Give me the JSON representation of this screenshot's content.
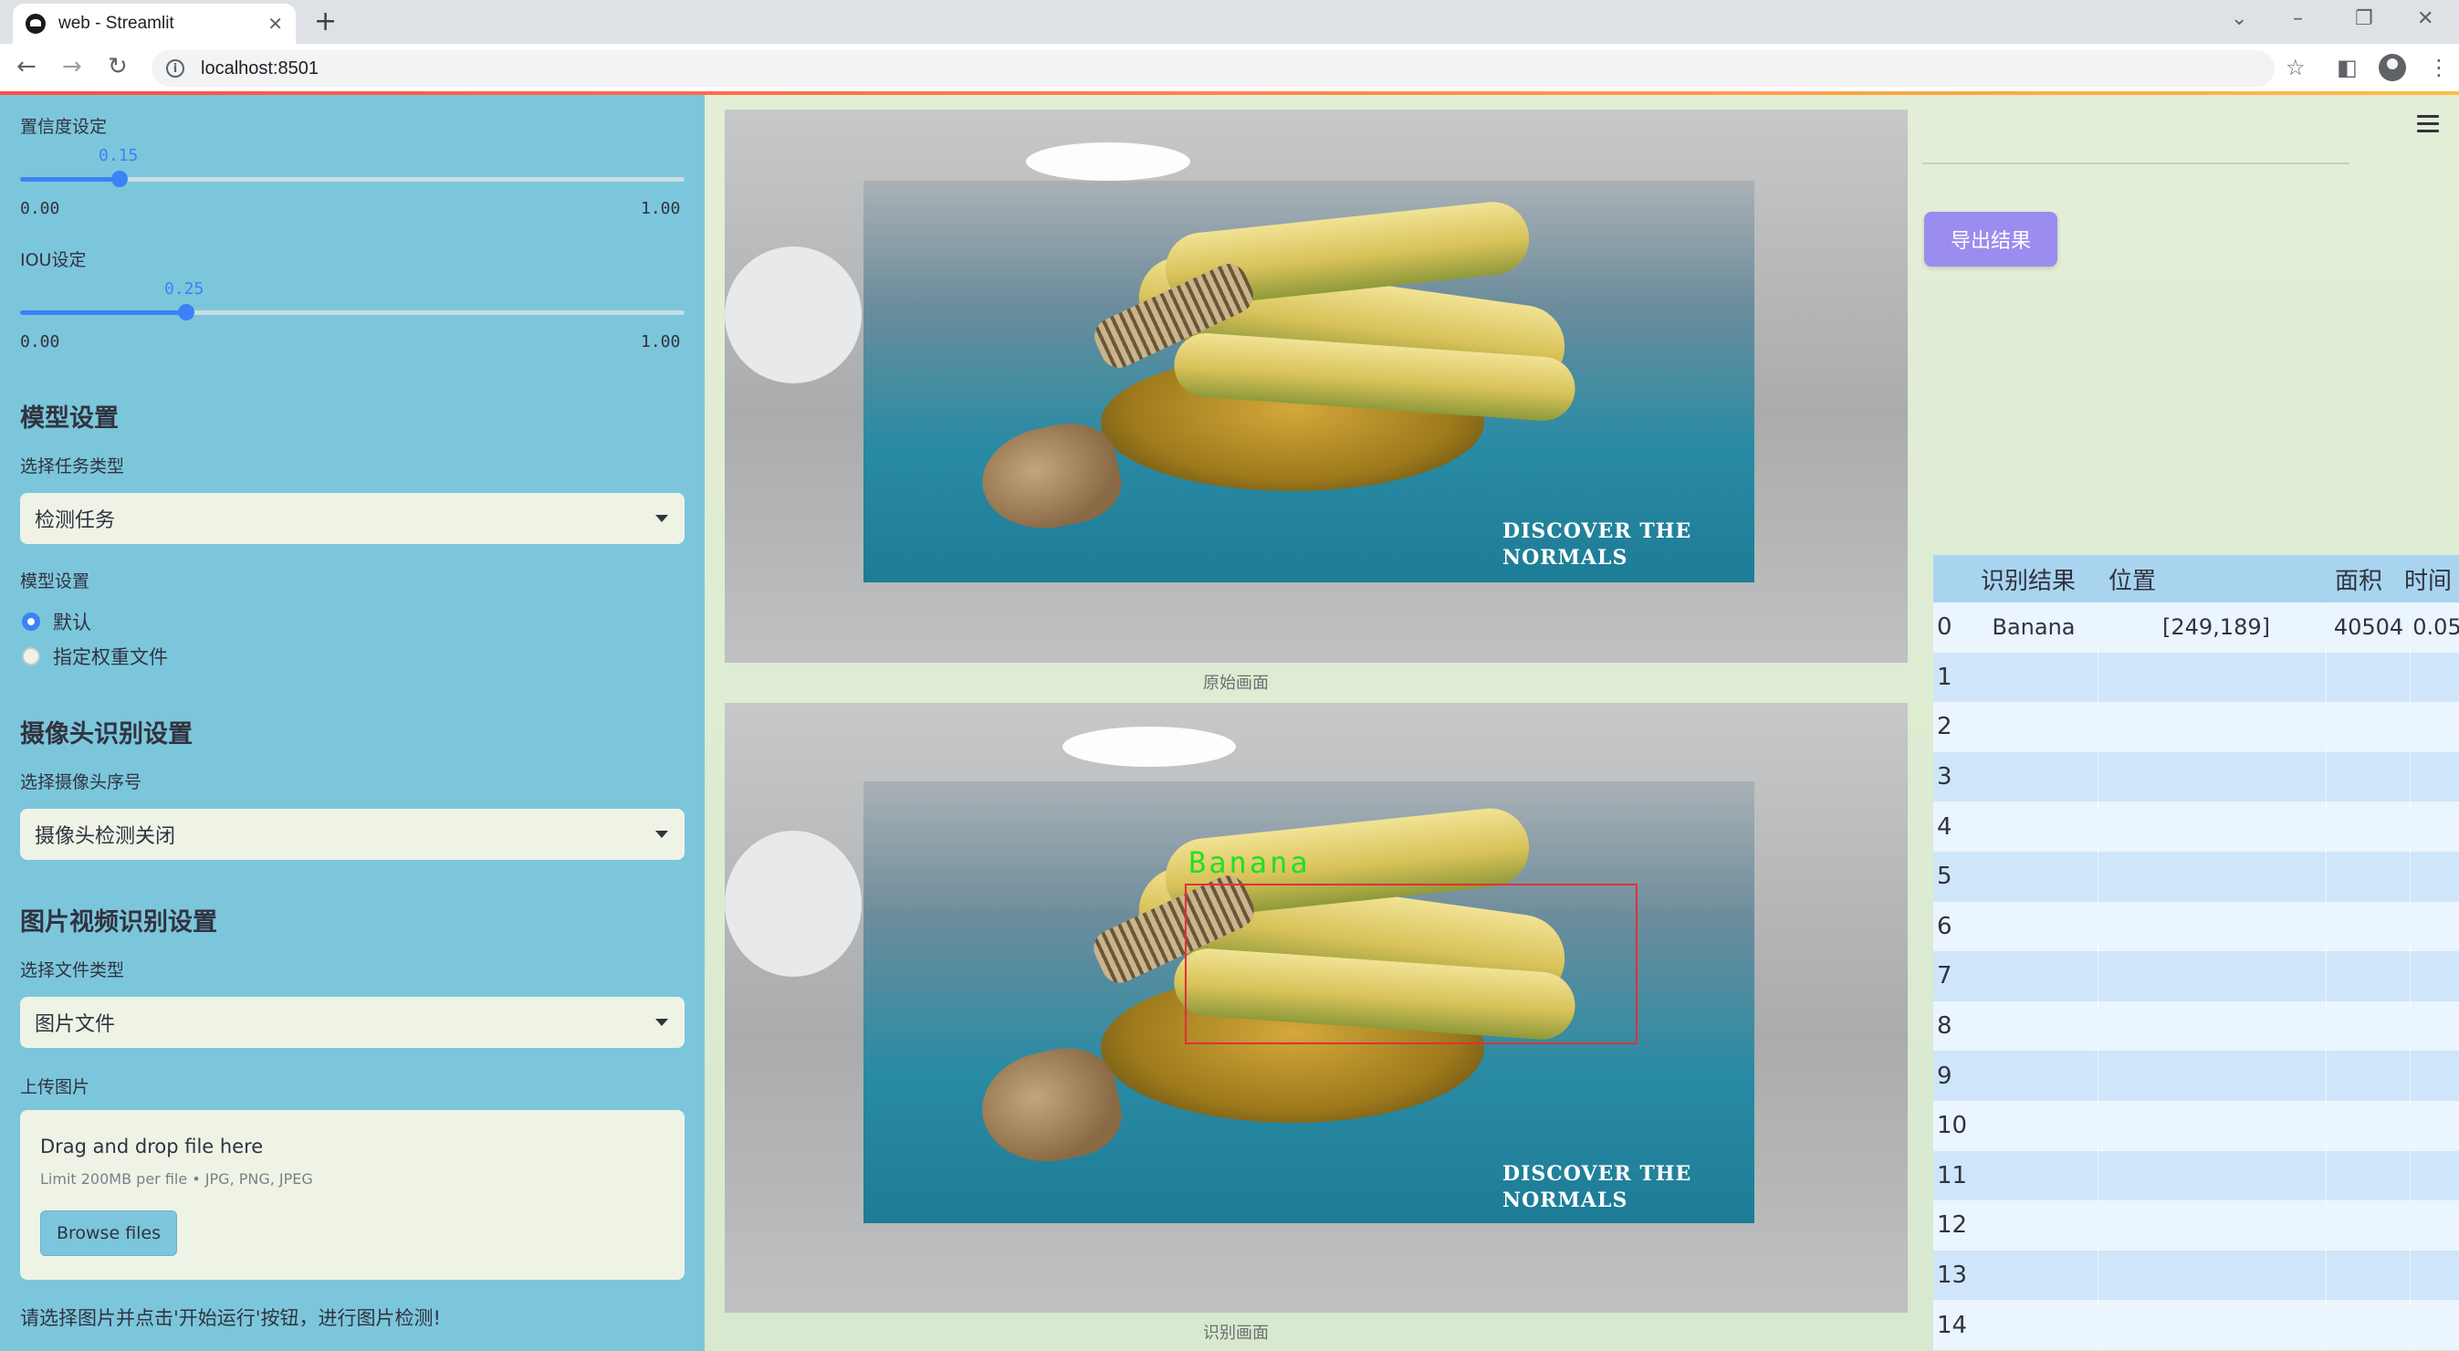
{
  "browser": {
    "tab_title": "web - Streamlit",
    "url": "localhost:8501",
    "new_tab_icon": "plus-icon",
    "close_tab_icon": "close-icon"
  },
  "sidebar": {
    "confidence": {
      "label": "置信度设定",
      "value": "0.15",
      "fraction": 0.15,
      "min": "0.00",
      "max": "1.00"
    },
    "iou": {
      "label": "IOU设定",
      "value": "0.25",
      "fraction": 0.25,
      "min": "0.00",
      "max": "1.00"
    },
    "model_section": {
      "heading": "模型设置",
      "task_label": "选择任务类型",
      "task_value": "检测任务",
      "model_label": "模型设置",
      "radio_options": [
        "默认",
        "指定权重文件"
      ],
      "radio_selected": 0
    },
    "camera_section": {
      "heading": "摄像头识别设置",
      "camera_label": "选择摄像头序号",
      "camera_value": "摄像头检测关闭"
    },
    "media_section": {
      "heading": "图片视频识别设置",
      "filetype_label": "选择文件类型",
      "filetype_value": "图片文件",
      "upload_label": "上传图片",
      "drop_text": "Drag and drop file here",
      "limit_text": "Limit 200MB per file • JPG, PNG, JPEG",
      "browse_label": "Browse files"
    },
    "hint": "请选择图片并点击'开始运行'按钮，进行图片检测!"
  },
  "main": {
    "original_caption": "原始画面",
    "detected_caption": "识别画面",
    "photo_text_line1": "DISCOVER THE",
    "photo_text_line2": "NORMALS",
    "detection_label": "Banana"
  },
  "right_panel": {
    "export_label": "导出结果",
    "menu_icon": "hamburger-menu-icon",
    "table": {
      "columns": [
        "",
        "识别结果",
        "位置",
        "面积",
        "时间"
      ],
      "rows": [
        {
          "index": "0",
          "result": "Banana",
          "position": "[249,189]",
          "area": "40504",
          "time": "0.05"
        },
        {
          "index": "1",
          "result": "",
          "position": "",
          "area": "",
          "time": ""
        },
        {
          "index": "2",
          "result": "",
          "position": "",
          "area": "",
          "time": ""
        },
        {
          "index": "3",
          "result": "",
          "position": "",
          "area": "",
          "time": ""
        },
        {
          "index": "4",
          "result": "",
          "position": "",
          "area": "",
          "time": ""
        },
        {
          "index": "5",
          "result": "",
          "position": "",
          "area": "",
          "time": ""
        },
        {
          "index": "6",
          "result": "",
          "position": "",
          "area": "",
          "time": ""
        },
        {
          "index": "7",
          "result": "",
          "position": "",
          "area": "",
          "time": ""
        },
        {
          "index": "8",
          "result": "",
          "position": "",
          "area": "",
          "time": ""
        },
        {
          "index": "9",
          "result": "",
          "position": "",
          "area": "",
          "time": ""
        },
        {
          "index": "10",
          "result": "",
          "position": "",
          "area": "",
          "time": ""
        },
        {
          "index": "11",
          "result": "",
          "position": "",
          "area": "",
          "time": ""
        },
        {
          "index": "12",
          "result": "",
          "position": "",
          "area": "",
          "time": ""
        },
        {
          "index": "13",
          "result": "",
          "position": "",
          "area": "",
          "time": ""
        },
        {
          "index": "14",
          "result": "",
          "position": "",
          "area": "",
          "time": ""
        }
      ]
    }
  },
  "colors": {
    "sidebar_bg": "#7cc6dc",
    "main_bg": "#e3eed6",
    "accent": "#3b82f6",
    "export_button": "#9b8cf0",
    "table_header": "#a8d4f0",
    "table_row_alt": "#cfe6fa",
    "detection_box": "#e0303c",
    "detection_text": "#22e022"
  }
}
